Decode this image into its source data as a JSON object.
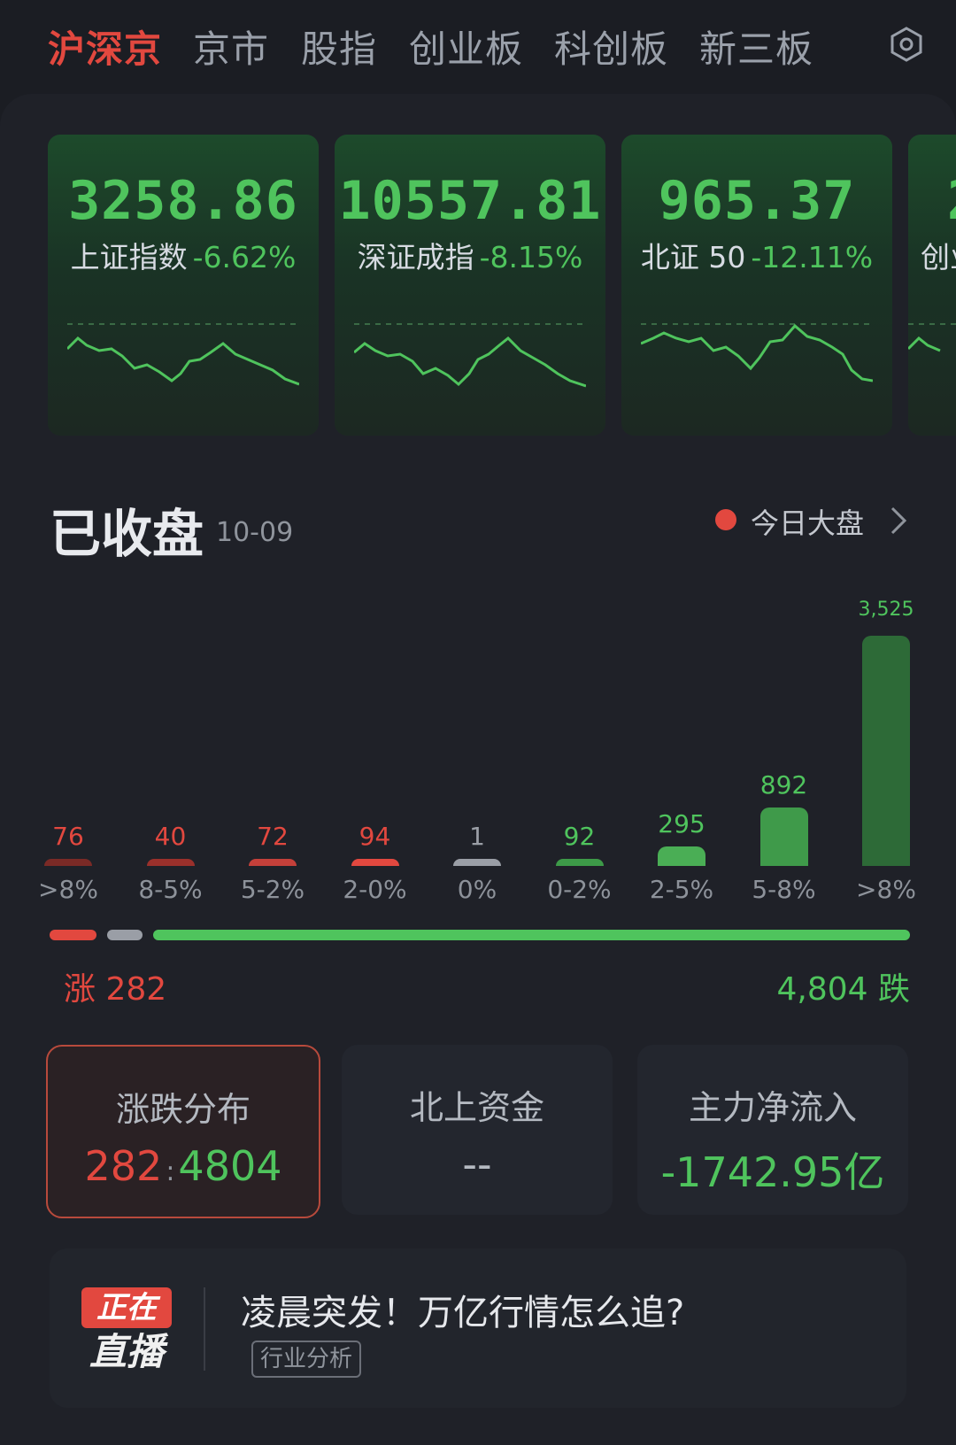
{
  "tabs": [
    {
      "label": "沪深京",
      "active": true
    },
    {
      "label": "京市",
      "active": false
    },
    {
      "label": "股指",
      "active": false
    },
    {
      "label": "创业板",
      "active": false
    },
    {
      "label": "科创板",
      "active": false
    },
    {
      "label": "新三板",
      "active": false
    }
  ],
  "settings_icon": "settings-hex-icon",
  "index_cards": [
    {
      "value": "3258.86",
      "name": "上证指数",
      "change": "-6.62%"
    },
    {
      "value": "10557.81",
      "name": "深证成指",
      "change": "-8.15%"
    },
    {
      "value": "965.37",
      "name": "北证 50",
      "change": "-12.11%"
    },
    {
      "value": "2",
      "name": "创业",
      "change": ""
    }
  ],
  "market_status": {
    "title": "已收盘",
    "date": "10-09"
  },
  "today_link": {
    "label": "今日大盘",
    "dot_color": "#e2483f"
  },
  "chart_data": {
    "type": "bar",
    "categories": [
      ">8%",
      "8-5%",
      "5-2%",
      "2-0%",
      "0%",
      "0-2%",
      "2-5%",
      "5-8%",
      ">8%"
    ],
    "values": [
      76,
      40,
      72,
      94,
      1,
      92,
      295,
      892,
      3525
    ],
    "value_labels": [
      "76",
      "40",
      "72",
      "94",
      "1",
      "92",
      "295",
      "892",
      "3,525"
    ],
    "colors": [
      "#7a2a26",
      "#9a302b",
      "#c4403a",
      "#e2483f",
      "#9a9ea6",
      "#3d9a48",
      "#4aae55",
      "#3f9a4a",
      "#2d6a37"
    ],
    "label_colors": [
      "#e2483f",
      "#e2483f",
      "#e2483f",
      "#e2483f",
      "#9a9ea6",
      "#4fc45d",
      "#4fc45d",
      "#4fc45d",
      "#4fc45d"
    ]
  },
  "ratio": {
    "up": 282,
    "flat": 1,
    "down": 4804,
    "up_label": "涨 282",
    "down_label": "4,804 跌"
  },
  "stats": [
    {
      "title": "涨跌分布",
      "value_up": "282",
      "sep": ":",
      "value_down": "4804",
      "selected": true
    },
    {
      "title": "北上资金",
      "value": "--",
      "selected": false
    },
    {
      "title": "主力净流入",
      "value": "-1742.95亿",
      "selected": false
    }
  ],
  "live": {
    "badge_top": "正在",
    "badge_bottom": "直播",
    "headline": "凌晨突发！万亿行情怎么追?",
    "tag": "行业分析"
  },
  "colors": {
    "up": "#e2483f",
    "down": "#4fc45d",
    "bg": "#1b1d23"
  }
}
